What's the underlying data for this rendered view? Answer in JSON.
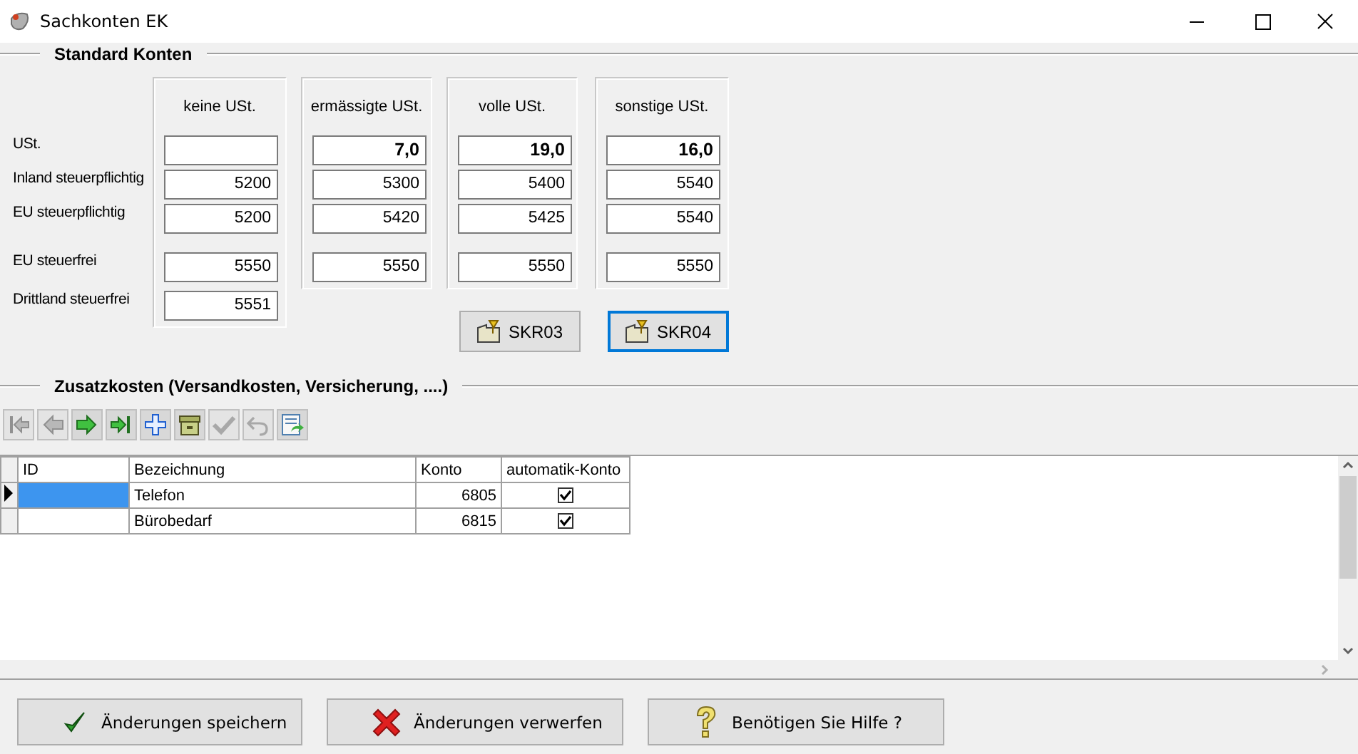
{
  "window": {
    "title": "Sachkonten EK"
  },
  "standard_konten": {
    "title": "Standard Konten",
    "rows": [
      {
        "label": "USt.",
        "kind": "rate"
      },
      {
        "label": "Inland steuerpflichtig",
        "kind": "account"
      },
      {
        "label": "EU steuerpflichtig",
        "kind": "account"
      },
      {
        "label": "EU steuerfrei",
        "kind": "account"
      },
      {
        "label": "Drittland steuerfrei",
        "kind": "account"
      }
    ],
    "columns": [
      {
        "header": "keine USt.",
        "values": [
          {
            "empty": true
          },
          {
            "value": "5200"
          },
          {
            "value": "5200"
          },
          {
            "value": "5550"
          },
          {
            "value": "5551"
          }
        ]
      },
      {
        "header": "ermässigte USt.",
        "values": [
          {
            "value": "7,0"
          },
          {
            "value": "5300"
          },
          {
            "value": "5420"
          },
          {
            "value": "5550"
          }
        ]
      },
      {
        "header": "volle USt.",
        "values": [
          {
            "value": "19,0"
          },
          {
            "value": "5400"
          },
          {
            "value": "5425"
          },
          {
            "value": "5550"
          }
        ]
      },
      {
        "header": "sonstige USt.",
        "values": [
          {
            "value": "16,0"
          },
          {
            "value": "5540"
          },
          {
            "value": "5540"
          },
          {
            "value": "5550"
          }
        ]
      }
    ],
    "presets": [
      {
        "label": "SKR03",
        "focused": false
      },
      {
        "label": "SKR04",
        "focused": true
      }
    ]
  },
  "zusatzkosten": {
    "title": "Zusatzkosten (Versandkosten, Versicherung, ....)",
    "toolbar": [
      {
        "kind": "first",
        "disabled": true
      },
      {
        "kind": "prior",
        "disabled": true
      },
      {
        "kind": "next",
        "disabled": false
      },
      {
        "kind": "last",
        "disabled": false
      },
      {
        "kind": "insert",
        "disabled": false
      },
      {
        "kind": "delete",
        "disabled": false
      },
      {
        "kind": "post",
        "disabled": true
      },
      {
        "kind": "cancel",
        "disabled": true
      },
      {
        "kind": "refresh",
        "disabled": false
      }
    ],
    "table": {
      "columns": [
        "ID",
        "Bezeichnung",
        "Konto",
        "automatik-Konto"
      ],
      "rows": [
        {
          "selected": true,
          "bezeichnung": "Telefon",
          "konto": "6805",
          "automatik": true
        },
        {
          "selected": false,
          "bezeichnung": "Bürobedarf",
          "konto": "6815",
          "automatik": true
        }
      ]
    }
  },
  "buttons": [
    {
      "kind": "save",
      "label": "Änderungen speichern"
    },
    {
      "kind": "discard",
      "label": "Änderungen verwerfen"
    },
    {
      "kind": "help",
      "label": "Benötigen Sie Hilfe ?"
    }
  ]
}
